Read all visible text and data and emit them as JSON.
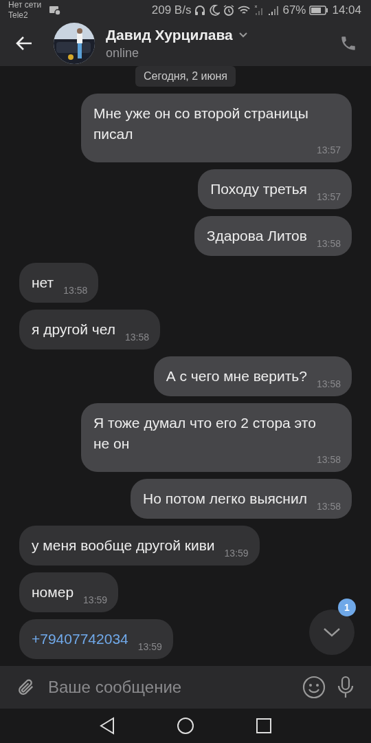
{
  "status_bar": {
    "network": "Нет сети",
    "carrier": "Tele2",
    "speed": "209 B/s",
    "battery": "67%",
    "time": "14:04"
  },
  "header": {
    "name": "Давид Хурцилава",
    "status": "online"
  },
  "date_pill": "Сегодня, 2 июня",
  "messages": [
    {
      "outgoing": true,
      "text": "Мне уже он со второй страницы писал",
      "time": "13:57"
    },
    {
      "outgoing": true,
      "text": "Походу третья",
      "time": "13:57"
    },
    {
      "outgoing": true,
      "text": "Здарова Литов",
      "time": "13:58"
    },
    {
      "outgoing": false,
      "text": "нет",
      "time": "13:58"
    },
    {
      "outgoing": false,
      "text": "я другой чел",
      "time": "13:58"
    },
    {
      "outgoing": true,
      "text": "А с чего мне верить?",
      "time": "13:58"
    },
    {
      "outgoing": true,
      "text": "Я тоже думал что его 2 стора это не он",
      "time": "13:58"
    },
    {
      "outgoing": true,
      "text": "Но потом легко выяснил",
      "time": "13:58"
    },
    {
      "outgoing": false,
      "text": "у меня вообще другой киви",
      "time": "13:59"
    },
    {
      "outgoing": false,
      "text": "номер",
      "time": "13:59"
    },
    {
      "outgoing": false,
      "kind": "link",
      "text": "+79407742034",
      "time": "13:59"
    }
  ],
  "scroll_badge": "1",
  "composer": {
    "placeholder": "Ваше сообщение"
  }
}
